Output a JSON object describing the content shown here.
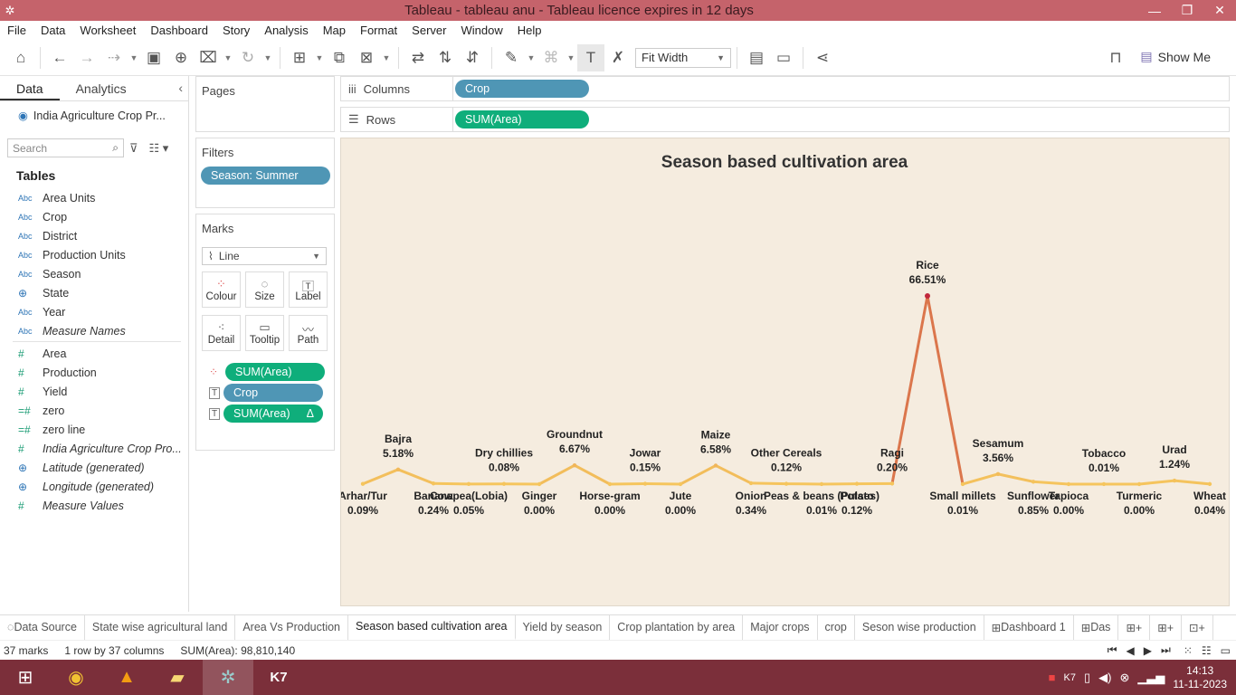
{
  "window": {
    "title": "Tableau - tableau anu - Tableau licence expires in 12 days"
  },
  "menu": [
    "File",
    "Data",
    "Worksheet",
    "Dashboard",
    "Story",
    "Analysis",
    "Map",
    "Format",
    "Server",
    "Window",
    "Help"
  ],
  "toolbar": {
    "fit": "Fit Width",
    "show_me": "Show Me"
  },
  "data_pane": {
    "tabs": [
      "Data",
      "Analytics"
    ],
    "source": "India Agriculture Crop Pr...",
    "search_placeholder": "Search",
    "tables_heading": "Tables",
    "dimensions": [
      {
        "icon": "Abc",
        "name": "Area Units",
        "italic": false
      },
      {
        "icon": "Abc",
        "name": "Crop",
        "italic": false
      },
      {
        "icon": "Abc",
        "name": "District",
        "italic": false
      },
      {
        "icon": "Abc",
        "name": "Production Units",
        "italic": false
      },
      {
        "icon": "Abc",
        "name": "Season",
        "italic": false
      },
      {
        "icon": "globe",
        "name": "State",
        "italic": false
      },
      {
        "icon": "Abc",
        "name": "Year",
        "italic": false
      },
      {
        "icon": "Abc",
        "name": "Measure Names",
        "italic": true
      }
    ],
    "measures": [
      {
        "icon": "#",
        "name": "Area",
        "italic": false
      },
      {
        "icon": "#",
        "name": "Production",
        "italic": false
      },
      {
        "icon": "#",
        "name": "Yield",
        "italic": false
      },
      {
        "icon": "=#",
        "name": "zero",
        "italic": false
      },
      {
        "icon": "=#",
        "name": "zero line",
        "italic": false
      },
      {
        "icon": "#",
        "name": "India Agriculture Crop Pro...",
        "italic": true
      },
      {
        "icon": "globe",
        "name": "Latitude (generated)",
        "italic": true
      },
      {
        "icon": "globe",
        "name": "Longitude (generated)",
        "italic": true
      },
      {
        "icon": "#",
        "name": "Measure Values",
        "italic": true
      }
    ]
  },
  "pages": {
    "label": "Pages"
  },
  "filters": {
    "label": "Filters",
    "items": [
      "Season: Summer"
    ]
  },
  "marks": {
    "label": "Marks",
    "type": "Line",
    "buttons": [
      "Colour",
      "Size",
      "Label",
      "Detail",
      "Tooltip",
      "Path"
    ],
    "pills": [
      {
        "icon": "colour",
        "text": "SUM(Area)",
        "color": "green"
      },
      {
        "icon": "T",
        "text": "Crop",
        "color": "blue"
      },
      {
        "icon": "T",
        "text": "SUM(Area)",
        "color": "green",
        "delta": "Δ"
      }
    ]
  },
  "shelves": {
    "columns_label": "Columns",
    "columns_pill": "Crop",
    "rows_label": "Rows",
    "rows_pill": "SUM(Area)"
  },
  "chart_data": {
    "type": "line",
    "title": "Season based cultivation area",
    "unit": "percent of total area",
    "categories": [
      "Arhar/Tur",
      "Bajra",
      "Banana",
      "Cowpea(Lobia)",
      "Dry chillies",
      "Ginger",
      "Groundnut",
      "Horse-gram",
      "Jowar",
      "Jute",
      "Maize",
      "Onion",
      "Other Cereals",
      "Peas & beans (Pulses)",
      "Potato",
      "Ragi",
      "Rice",
      "Small millets",
      "Sesamum",
      "Sunflower",
      "Tapioca",
      "Tobacco",
      "Turmeric",
      "Urad",
      "Wheat"
    ],
    "labels_pct": [
      "0.09%",
      "5.18%",
      "0.24%",
      "0.05%",
      "0.08%",
      "0.00%",
      "6.67%",
      "0.00%",
      "0.15%",
      "0.00%",
      "6.58%",
      "0.34%",
      "0.12%",
      "0.01%",
      "0.12%",
      "0.20%",
      "66.51%",
      "0.01%",
      "3.56%",
      "0.85%",
      "0.00%",
      "0.01%",
      "0.00%",
      "1.24%",
      "0.04%"
    ],
    "values": [
      0.09,
      5.18,
      0.24,
      0.05,
      0.08,
      0.0,
      6.67,
      0.0,
      0.15,
      0.0,
      6.58,
      0.34,
      0.12,
      0.01,
      0.12,
      0.2,
      66.51,
      0.01,
      3.56,
      0.85,
      0.0,
      0.01,
      0.0,
      1.24,
      0.04
    ],
    "label_above": [
      false,
      true,
      false,
      false,
      true,
      false,
      true,
      false,
      true,
      false,
      true,
      false,
      true,
      false,
      false,
      true,
      true,
      false,
      true,
      false,
      false,
      true,
      false,
      true,
      false
    ],
    "colors": {
      "low": "#f5c55d",
      "high": "#c1283c",
      "background": "#f5ecdf"
    }
  },
  "sheet_tabs": [
    "Data Source",
    "State wise agricultural land",
    "Area Vs Production",
    "Season based cultivation area",
    "Yield by season",
    "Crop plantation by area",
    "Major crops",
    "crop",
    "Seson wise production",
    "Dashboard 1",
    "Das"
  ],
  "active_tab": "Season based cultivation area",
  "status": {
    "marks": "37 marks",
    "rows_cols": "1 row by 37 columns",
    "sum": "SUM(Area): 98,810,140"
  },
  "taskbar": {
    "time": "14:13",
    "date": "11-11-2023"
  }
}
